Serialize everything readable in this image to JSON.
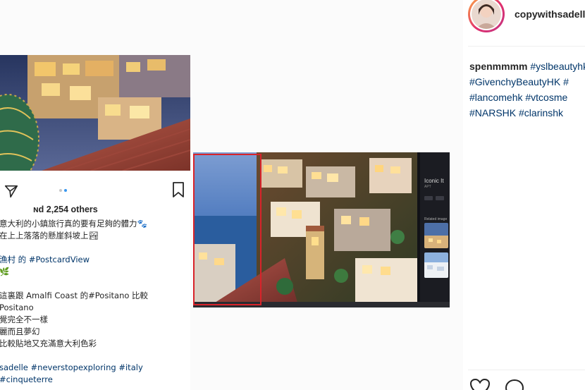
{
  "phone_post": {
    "likes_text": "ɴd 2,254 others",
    "carousel_active_index": 1,
    "caption_lines": [
      "意大利的小鎮旅行真的要有足夠的體力🐾",
      "在上上落落的懸崖斜坡上🏞",
      "",
      "漁村 的 #PostcardView",
      "🌿",
      "",
      "這裏跟 Amalfi Coast 的#Positano 比較",
      " Positano",
      "覺完全不一樣",
      "麗而且夢幻",
      "比較貼地又充滿意大利色彩",
      "",
      "sadelle #neverstopexploring #italy",
      "#cinqueterre"
    ]
  },
  "web_screenshot": {
    "side_title": "Iconic It",
    "side_subtitle": "APT",
    "related_label": "Related image",
    "highlight_color": "#d9232a"
  },
  "right_panel": {
    "username": "copywithsadelle",
    "comment_user": "spenmmmm",
    "comment_lines": [
      "#yslbeautyhk",
      "#GivenchyBeautyHK #",
      "#lancomehk #vtcosme",
      "#NARSHK #clarinshk"
    ]
  },
  "colors": {
    "hashtag": "#003569",
    "carousel_active": "#3897f0",
    "story_ring_start": "#fdb045",
    "story_ring_end": "#c13584"
  },
  "icons": {
    "share": "paper-plane-icon",
    "bookmark": "bookmark-icon",
    "like": "heart-icon",
    "comment": "comment-bubble-icon"
  }
}
